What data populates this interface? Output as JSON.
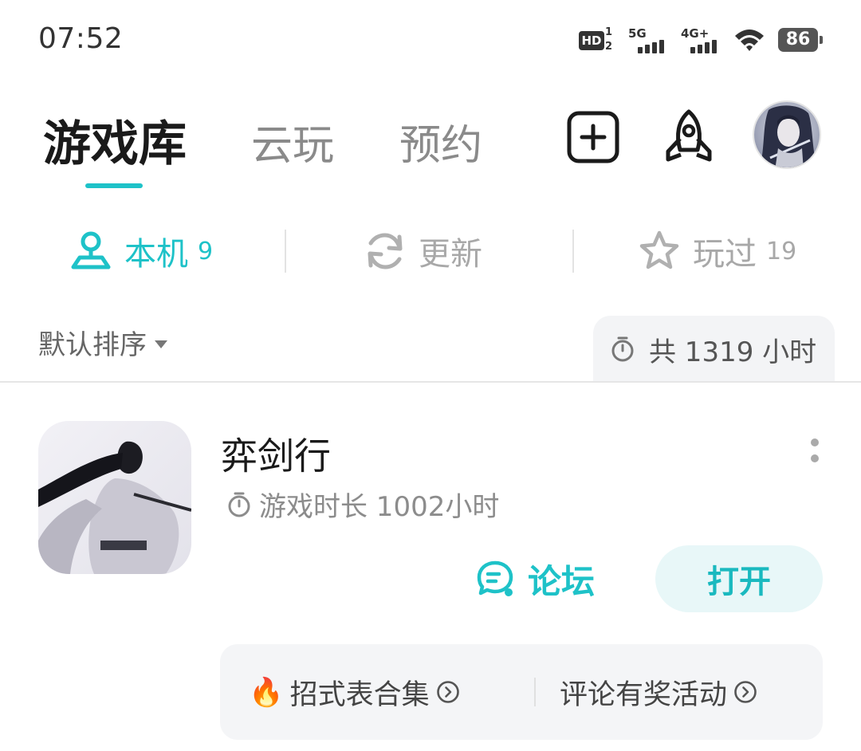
{
  "status_bar": {
    "time": "07:52",
    "hd_label": "HD",
    "hd_sup": "1",
    "hd_sub": "2",
    "sim1_label": "5G",
    "sim2_label": "4G+",
    "battery": "86"
  },
  "top_tabs": [
    {
      "label": "游戏库",
      "active": true
    },
    {
      "label": "云玩",
      "active": false
    },
    {
      "label": "预约",
      "active": false
    }
  ],
  "top_actions": [
    {
      "icon": "plus-square-icon"
    },
    {
      "icon": "rocket-icon"
    },
    {
      "icon": "avatar"
    }
  ],
  "sub_tabs": [
    {
      "label": "本机",
      "count": "9",
      "icon": "local-device-icon",
      "active": true
    },
    {
      "label": "更新",
      "count": "",
      "icon": "refresh-icon",
      "active": false
    },
    {
      "label": "玩过",
      "count": "19",
      "icon": "star-outline-icon",
      "active": false
    }
  ],
  "sort": {
    "label": "默认排序"
  },
  "total_time": {
    "label": "共 1319 小时"
  },
  "game": {
    "title": "弈剑行",
    "play_time": "游戏时长 1002小时",
    "forum_label": "论坛",
    "open_label": "打开",
    "links": [
      {
        "label": "招式表合集",
        "emoji": "🔥"
      },
      {
        "label": "评论有奖活动",
        "emoji": ""
      }
    ]
  },
  "colors": {
    "accent": "#1ec2c8",
    "open_button_bg": "#e8f7f8",
    "panel_bg": "#f4f5f7",
    "muted_text": "#8c8c8c"
  }
}
